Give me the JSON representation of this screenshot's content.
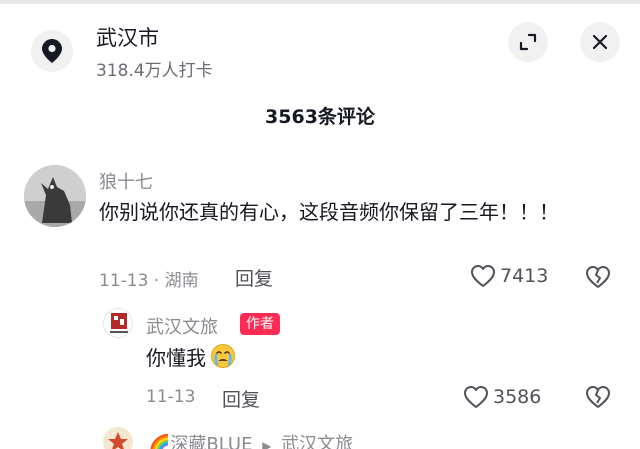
{
  "location": {
    "name": "武汉市",
    "checkins": "318.4万人打卡"
  },
  "comments_header": {
    "count_label": "3563条评论"
  },
  "comments": [
    {
      "username": "狼十七",
      "text": "你别说你还真的有心，这段音频你保留了三年！！！",
      "date_location": "11-13 · 湖南",
      "reply_label": "回复",
      "likes": "7413"
    }
  ],
  "replies": [
    {
      "username": "武汉文旅",
      "badge": "作者",
      "text": "你懂我",
      "date": "11-13",
      "reply_label": "回复",
      "likes": "3586"
    },
    {
      "username": "🌈深藏BLUE",
      "reply_to_arrow": "▶",
      "reply_to": "武汉文旅"
    }
  ],
  "colors": {
    "accent": "#fe2c55",
    "secondary_text": "#8a8b91"
  }
}
